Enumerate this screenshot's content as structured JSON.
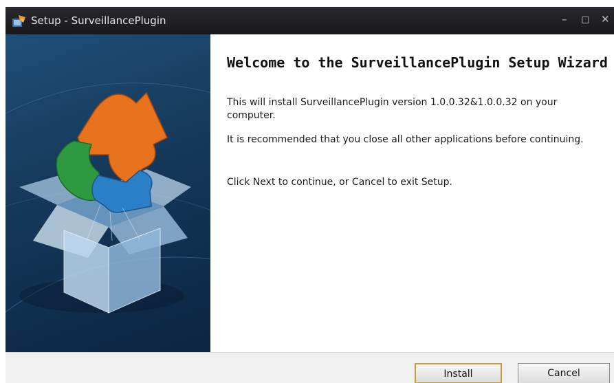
{
  "window": {
    "title": "Setup - SurveillancePlugin"
  },
  "welcome": {
    "heading": "Welcome to the SurveillancePlugin Setup Wizard",
    "install_text": "This will install SurveillancePlugin version 1.0.0.32&1.0.0.32 on your computer.",
    "recommend_text": "It is recommended that you close all other applications before continuing.",
    "instruction_text": "Click Next to continue, or Cancel to exit Setup."
  },
  "buttons": {
    "install_label": "Install",
    "cancel_label": "Cancel"
  },
  "icons": {
    "app": "setup-installer-icon",
    "banner": "puzzle-box-illustration",
    "minimize": "minimize-icon",
    "maximize": "maximize-icon",
    "close": "close-icon"
  },
  "colors": {
    "titlebar": "#1e1e22",
    "panel": "#15385a",
    "puzzle_orange": "#e8731e",
    "puzzle_green": "#2d9a40",
    "puzzle_blue": "#2b7fc6",
    "install_border": "#c79b3e"
  }
}
